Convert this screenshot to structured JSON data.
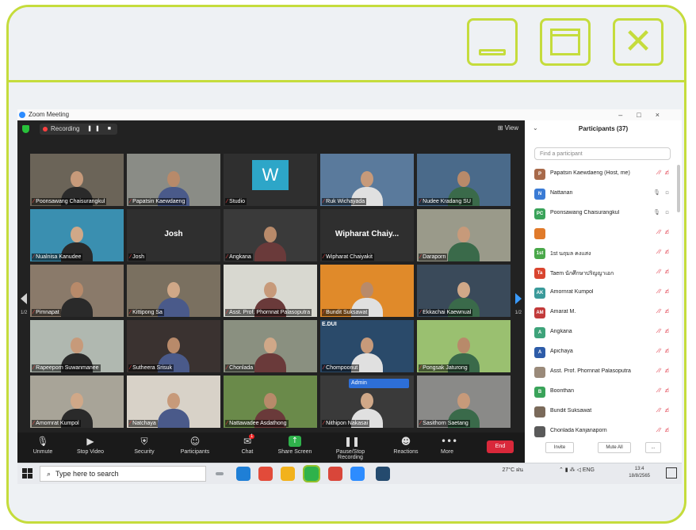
{
  "screen": {
    "window_title": "Zoom Meeting",
    "recording_label": "Recording",
    "view_label": "View",
    "end_label": "End",
    "toolbar": [
      {
        "icon": "mic-icon",
        "label": "Unmute"
      },
      {
        "icon": "video-icon",
        "label": "Stop Video"
      },
      {
        "icon": "shield-icon",
        "label": "Security"
      },
      {
        "icon": "participants-icon",
        "label": "Participants"
      },
      {
        "icon": "chat-icon",
        "label": "Chat",
        "count": "1"
      },
      {
        "icon": "share-icon",
        "label": "Share Screen"
      },
      {
        "icon": "pause-recording-icon",
        "label": "Pause/Stop Recording"
      },
      {
        "icon": "reactions-icon",
        "label": "Reactions"
      },
      {
        "icon": "more-icon",
        "label": "More"
      }
    ]
  },
  "tiles": [
    {
      "name": "Poonsawang Chaisurangkul"
    },
    {
      "name": "Papatsin Kaewdaeng"
    },
    {
      "name": "Studio",
      "letter": "W"
    },
    {
      "name": "Ruk Wichayada"
    },
    {
      "name": "Nudee Kradang SU"
    },
    {
      "name": "Nualnisa Kanudee"
    },
    {
      "name": "Josh",
      "big": "Josh"
    },
    {
      "name": "Angkana"
    },
    {
      "name": "Wipharat Chaiyakit",
      "big": "Wipharat Chaiy..."
    },
    {
      "name": "Daraporn"
    },
    {
      "name": "Pimnapat"
    },
    {
      "name": "Kittipong Sa"
    },
    {
      "name": "Asst. Prof. Phornnat Palasoputra"
    },
    {
      "name": "Bundit Suksawat"
    },
    {
      "name": "Ekkachai Kaewnual"
    },
    {
      "name": "Rapeeporn Suwanmanee"
    },
    {
      "name": "Sutheera Srisuk"
    },
    {
      "name": "Chonlada"
    },
    {
      "name": "Chompoonut",
      "badge": "E.DUI"
    },
    {
      "name": "Pongsak Jaturong"
    },
    {
      "name": "Amornrat Kumpol"
    },
    {
      "name": "Natchaya"
    },
    {
      "name": "Nattawadee Asdathong"
    },
    {
      "name": "Nithipon Nakasai",
      "chip": "Admin"
    },
    {
      "name": "Sasithorn Saetang"
    }
  ],
  "participants": {
    "title": "Participants (37)",
    "search_placeholder": "Find a participant",
    "rows": [
      {
        "initials": "P",
        "name": "Papatsin Kaewdaeng (Host, me)",
        "color": "#a86a4a",
        "muted": true
      },
      {
        "initials": "N",
        "name": "Nattanan",
        "color": "#3a7bd5",
        "muted": false
      },
      {
        "initials": "PC",
        "name": "Poonsawang Chaisurangkul",
        "color": "#3aa35a",
        "muted": false
      },
      {
        "initials": "",
        "name": "",
        "color": "#e07a2a",
        "muted": true
      },
      {
        "initials": "1st",
        "name": "1st นฤมล คงแสง",
        "color": "#4aa84a",
        "muted": true
      },
      {
        "initials": "Ta",
        "name": "Taem นักศึกษาปริญญาเอก",
        "color": "#d9452f",
        "muted": true
      },
      {
        "initials": "AK",
        "name": "Amornrat Kumpol",
        "color": "#3a9a9a",
        "muted": true
      },
      {
        "initials": "AM",
        "name": "Amarat M.",
        "color": "#c23a3a",
        "muted": true
      },
      {
        "initials": "A",
        "name": "Angkana",
        "color": "#3ea37a",
        "muted": true
      },
      {
        "initials": "A",
        "name": "Apichaya",
        "color": "#2e5ca8",
        "muted": true
      },
      {
        "initials": "",
        "name": "Asst. Prof. Phornnat Palasoputra",
        "color": "#9a8a7a",
        "muted": true
      },
      {
        "initials": "B",
        "name": "Boonthan",
        "color": "#3aa35a",
        "muted": true
      },
      {
        "initials": "",
        "name": "Bundit Suksawat",
        "color": "#7a6a5a",
        "muted": true
      },
      {
        "initials": "",
        "name": "Chonlada Kanjanaporn",
        "color": "#5a5a5a",
        "muted": true
      }
    ],
    "invite_label": "Invite",
    "mute_all_label": "Mute All",
    "more_label": "..."
  },
  "taskbar": {
    "search_placeholder": "Type here to search",
    "weather": "27°C ฝน",
    "time": "13:4",
    "date": "18/8/2565"
  }
}
